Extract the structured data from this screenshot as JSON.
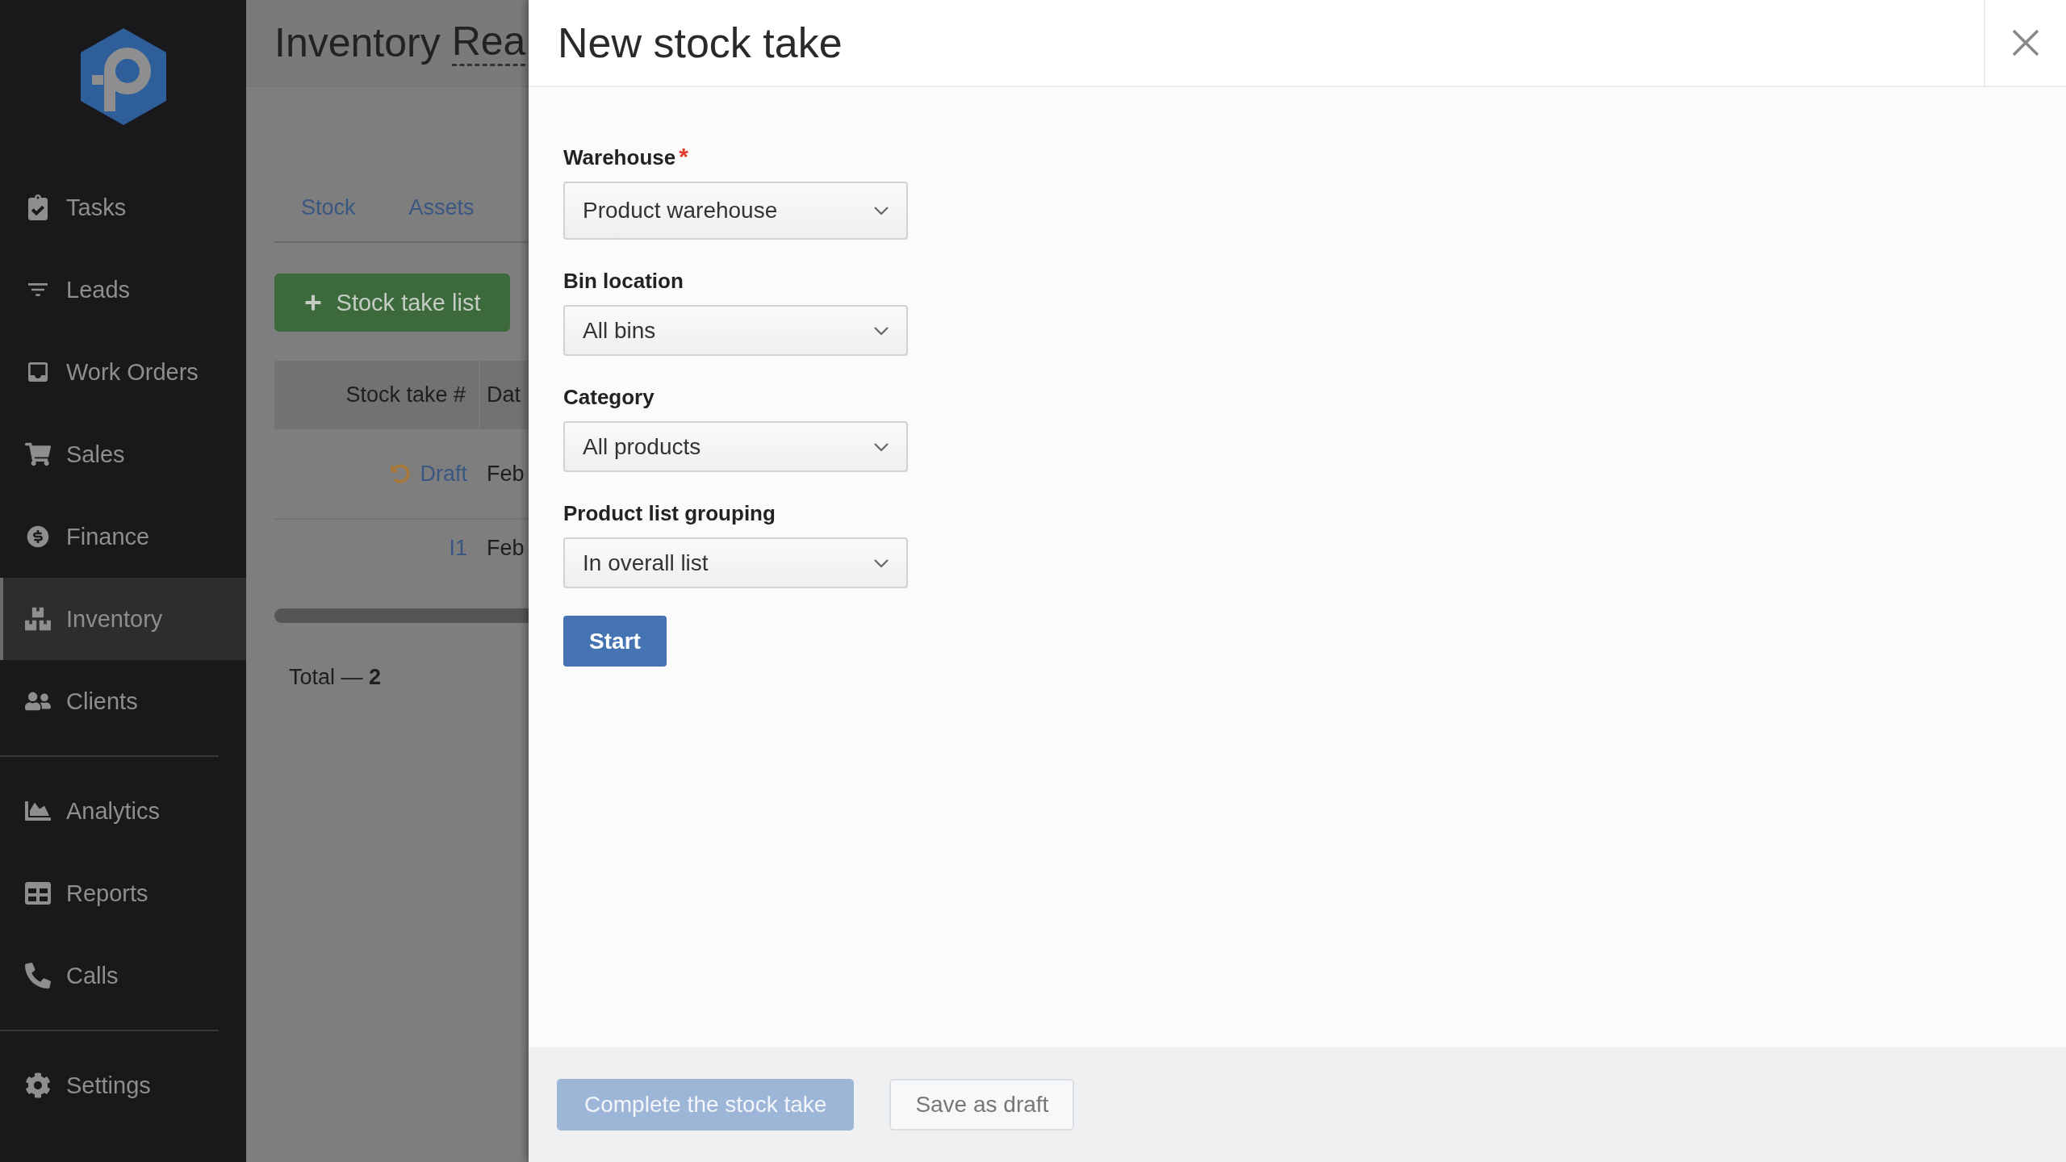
{
  "sidebar": {
    "sections": [
      {
        "items": [
          {
            "label": "Tasks",
            "selected": false
          },
          {
            "label": "Leads",
            "selected": false
          },
          {
            "label": "Work Orders",
            "selected": false
          },
          {
            "label": "Sales",
            "selected": false
          },
          {
            "label": "Finance",
            "selected": false
          },
          {
            "label": "Inventory",
            "selected": true
          },
          {
            "label": "Clients",
            "selected": false
          }
        ]
      },
      {
        "items": [
          {
            "label": "Analytics",
            "selected": false
          },
          {
            "label": "Reports",
            "selected": false
          },
          {
            "label": "Calls",
            "selected": false
          }
        ]
      },
      {
        "items": [
          {
            "label": "Settings",
            "selected": false
          }
        ]
      }
    ]
  },
  "page": {
    "title": "Inventory",
    "title_link": "Rea",
    "tabs": [
      {
        "label": "Stock",
        "selected": false
      },
      {
        "label": "Assets",
        "selected": false
      }
    ],
    "add_button": "Stock take list",
    "table": {
      "columns": [
        "Stock take #",
        "Dat"
      ],
      "rows": [
        {
          "kind": "draft",
          "number": "Draft",
          "date": "Feb"
        },
        {
          "kind": "number",
          "number": "I1",
          "date": "Feb"
        }
      ]
    },
    "total": "Total — **2**"
  },
  "drawer": {
    "title": "New stock take",
    "fields": [
      {
        "label": "Warehouse",
        "required_mark": "*",
        "value": "Product warehouse"
      },
      {
        "label": "Bin location",
        "value": "All bins"
      },
      {
        "label": "Category",
        "value": "All products"
      },
      {
        "label": "Product list grouping",
        "value": "In overall list"
      }
    ],
    "start_button": "Start",
    "footer": {
      "complete_button": {
        "label": "Complete the stock take",
        "disabled": true
      },
      "draft_button": {
        "label": "Save as draft",
        "disabled": false
      }
    }
  }
}
